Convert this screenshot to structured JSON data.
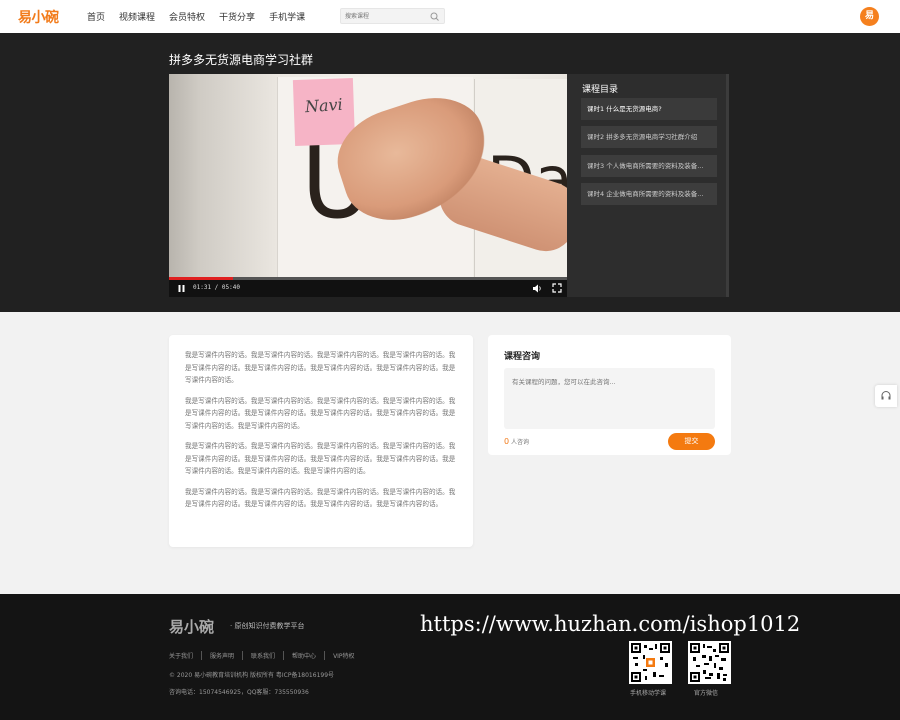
{
  "header": {
    "logo": "易小碗",
    "nav": [
      "首页",
      "视频课程",
      "会员特权",
      "干货分享",
      "手机学课"
    ],
    "search_placeholder": "搜索课程",
    "avatar_text": "易"
  },
  "course": {
    "title": "拼多多无货源电商学习社群",
    "player": {
      "sticky_note_text": "Navi",
      "time": "01:31 / 05:40",
      "progress": 0.16
    },
    "catalog": {
      "title": "课程目录",
      "lessons": [
        "课时1 什么是无货源电商?",
        "课时2 拼多多无货源电商学习社群介绍",
        "课时3 个人做电商所需要的资料及装备...",
        "课时4 企业做电商所需要的资料及装备..."
      ]
    }
  },
  "description": {
    "paragraphs": [
      "我是写课件内容的话。我是写课件内容的话。我是写课件内容的话。我是写课件内容的话。我是写课件内容的话。我是写课件内容的话。我是写课件内容的话。我是写课件内容的话。我是写课件内容的话。",
      "我是写课件内容的话。我是写课件内容的话。我是写课件内容的话。我是写课件内容的话。我是写课件内容的话。我是写课件内容的话。我是写课件内容的话。我是写课件内容的话。我是写课件内容的话。我是写课件内容的话。",
      "我是写课件内容的话。我是写课件内容的话。我是写课件内容的话。我是写课件内容的话。我是写课件内容的话。我是写课件内容的话。我是写课件内容的话。我是写课件内容的话。我是写课件内容的话。我是写课件内容的话。我是写课件内容的话。",
      "我是写课件内容的话。我是写课件内容的话。我是写课件内容的话。我是写课件内容的话。我是写课件内容的话。我是写课件内容的话。我是写课件内容的话。我是写课件内容的话。"
    ]
  },
  "consult": {
    "title": "课程咨询",
    "placeholder": "有关课程的问题，您可以在此咨询...",
    "count": "0",
    "count_label": "人咨询",
    "submit_label": "提交"
  },
  "footer": {
    "logo": "易小碗",
    "slogan": "· 原创知识付费教学平台",
    "links": [
      "关于我们",
      "服务声明",
      "联系我们",
      "帮助中心",
      "VIP特权"
    ],
    "copyright": "© 2020 易小碗教育培训机构 版权所有 粤ICP备18016199号",
    "contact": "咨询电话：15074546925，QQ客服：735550936",
    "watermark": "https://www.huzhan.com/ishop1012",
    "qr_labels": [
      "手机移动学课",
      "官方微信"
    ]
  },
  "colors": {
    "accent": "#f47a10",
    "hero_bg": "#212121",
    "footer_bg": "#141414"
  }
}
